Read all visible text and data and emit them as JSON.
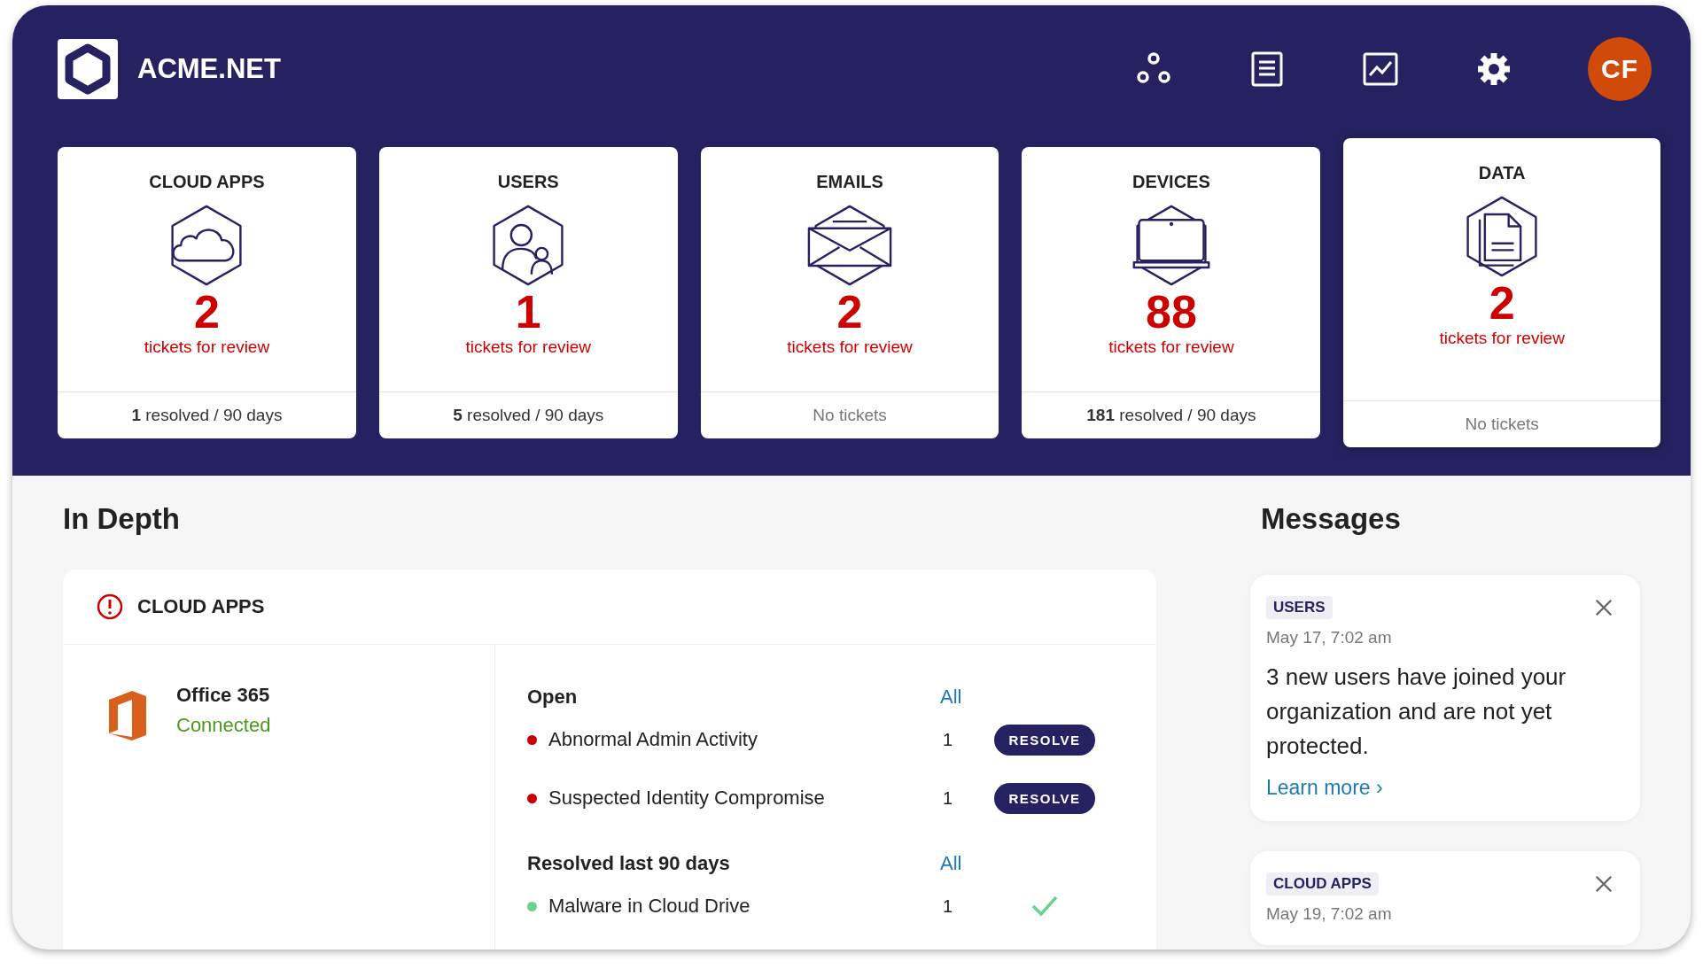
{
  "header": {
    "brand": "ACME.NET",
    "avatar": "CF"
  },
  "categories": [
    {
      "kind": "cloud",
      "title": "CLOUD APPS",
      "count": "2",
      "caption": "tickets for review",
      "footer": "**1** resolved / 90 days",
      "selected": false
    },
    {
      "kind": "users",
      "title": "USERS",
      "count": "1",
      "caption": "tickets for review",
      "footer": "**5** resolved / 90 days",
      "selected": false
    },
    {
      "kind": "emails",
      "title": "EMAILS",
      "count": "2",
      "caption": "tickets for review",
      "footer": "No tickets",
      "selected": false
    },
    {
      "kind": "devices",
      "title": "DEVICES",
      "count": "88",
      "caption": "tickets for review",
      "footer": "**181** resolved / 90 days",
      "selected": false
    },
    {
      "kind": "data",
      "title": "DATA",
      "count": "2",
      "caption": "tickets for review",
      "footer": "No tickets",
      "selected": true
    }
  ],
  "in_depth": {
    "heading": "In Depth",
    "panel_title": "CLOUD APPS",
    "app": {
      "name": "Office 365",
      "status": "Connected"
    },
    "groups": [
      {
        "title": "Open",
        "link": "All",
        "items": [
          {
            "kind": "open",
            "name": "Abnormal Admin Activity",
            "count": "1",
            "color": "#cc0000",
            "action": "RESOLVE"
          },
          {
            "kind": "open",
            "name": "Suspected Identity Compromise",
            "count": "1",
            "color": "#cc0000",
            "action": "RESOLVE"
          }
        ]
      },
      {
        "title": "Resolved last 90 days",
        "link": "All",
        "items": [
          {
            "kind": "resolved",
            "name": "Malware in Cloud Drive",
            "count": "1",
            "color": "#6fd08c"
          }
        ]
      }
    ]
  },
  "messages": {
    "heading": "Messages",
    "items": [
      {
        "tag": "USERS",
        "date": "May 17, 7:02 am",
        "text": "3 new users have joined your organization and are not yet protected.",
        "link": "Learn more ›"
      },
      {
        "tag": "CLOUD APPS",
        "date": "May 19, 7:02 am"
      }
    ]
  }
}
